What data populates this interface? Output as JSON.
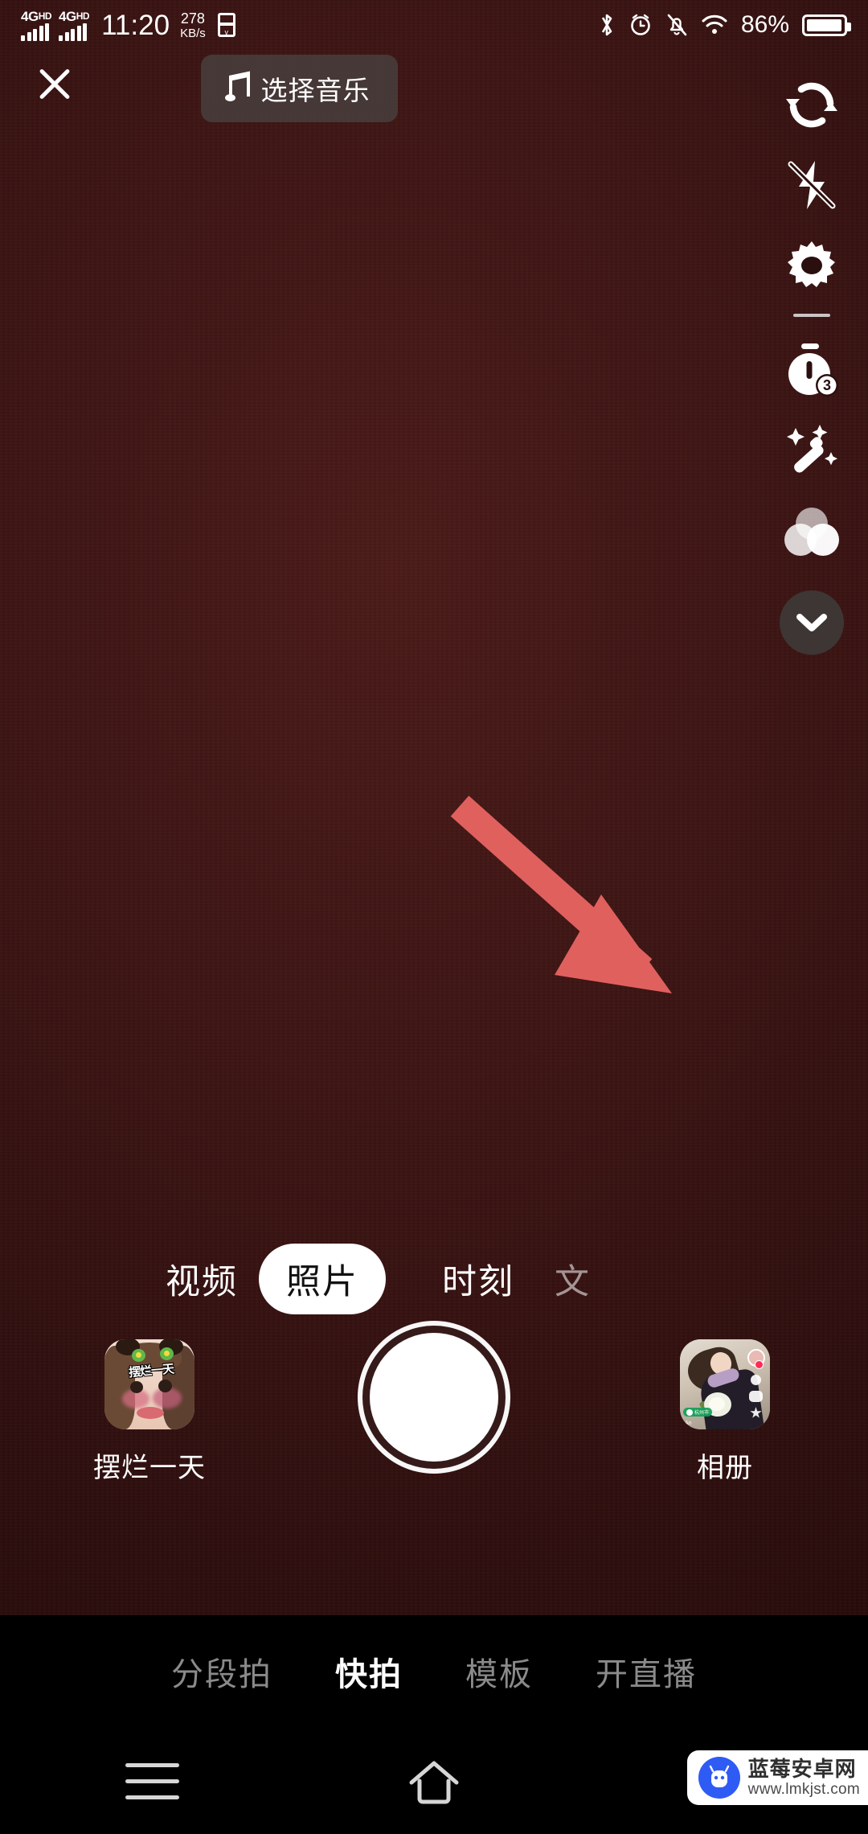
{
  "status_bar": {
    "network_1": "4G",
    "network_1_sup": "HD",
    "network_2": "4G",
    "network_2_sup": "HD",
    "clock": "11:20",
    "data_rate_value": "278",
    "data_rate_unit": "KB/s",
    "icons": [
      "sim-card-icon",
      "bluetooth-icon",
      "alarm-icon",
      "mute-bell-icon",
      "wifi-icon"
    ],
    "battery_percent": "86%"
  },
  "top_bar": {
    "close_label": "close-icon",
    "music_label": "选择音乐",
    "music_icon": "music-note-icon"
  },
  "tool_rail": {
    "items": [
      {
        "name": "flip-camera-icon",
        "label": "翻转"
      },
      {
        "name": "flash-off-icon",
        "label": "闪光灯关闭"
      },
      {
        "name": "gear-icon",
        "label": "设置"
      },
      {
        "name": "timer-icon",
        "label": "倒计时",
        "badge": "3"
      },
      {
        "name": "magic-wand-icon",
        "label": "美化"
      },
      {
        "name": "filters-icon",
        "label": "滤镜"
      }
    ],
    "collapse_icon": "chevron-down-icon"
  },
  "mode_selector": {
    "modes": [
      {
        "label": "视频",
        "selected": false
      },
      {
        "label": "照片",
        "selected": true
      },
      {
        "label": "时刻",
        "selected": false
      },
      {
        "label": "文",
        "selected": false
      }
    ]
  },
  "capture_row": {
    "effect": {
      "label": "摆烂一天",
      "thumb_caption": "摆烂一天"
    },
    "shutter": "shutter-button",
    "album": {
      "label": "相册",
      "geo_tag": "杭州市",
      "username": "An"
    }
  },
  "bottom_tabs": {
    "tabs": [
      {
        "label": "分段拍",
        "active": false
      },
      {
        "label": "快拍",
        "active": true
      },
      {
        "label": "模板",
        "active": false
      },
      {
        "label": "开直播",
        "active": false
      }
    ]
  },
  "android_nav": {
    "menu": "menu-icon",
    "home": "home-icon",
    "back": "back-icon"
  },
  "watermark": {
    "title": "蓝莓安卓网",
    "url": "www.lmkjst.com"
  },
  "colors": {
    "accent_red": "#e0605e",
    "viewfinder": "#3a1312",
    "chrome_black": "#000000",
    "active_pill": "#ffffff"
  }
}
